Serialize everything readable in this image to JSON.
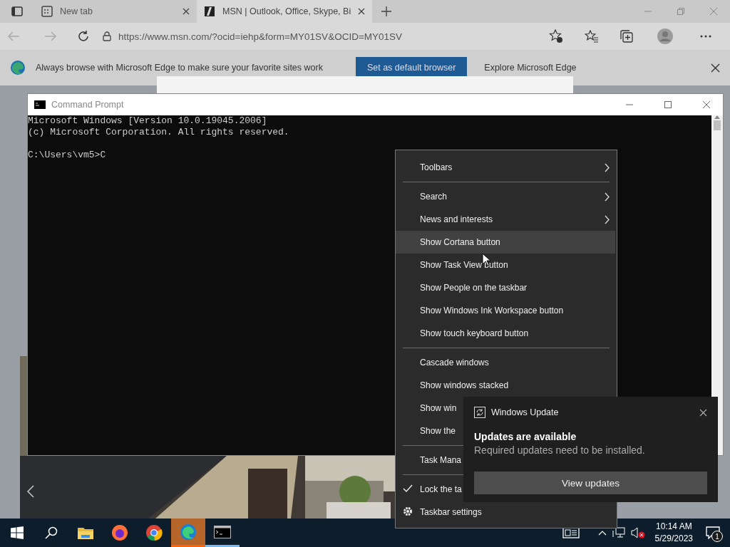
{
  "browser": {
    "tabs": [
      {
        "title": "New tab",
        "selected": false
      },
      {
        "title": "MSN | Outlook, Office, Skype, Bi",
        "selected": true
      }
    ],
    "address": "https://www.msn.com/?ocid=iehp&form=MY01SV&OCID=MY01SV",
    "infobar": {
      "message": "Always browse with Microsoft Edge to make sure your favorite sites work",
      "primary_button": "Set as default browser",
      "secondary_button": "Explore Microsoft Edge"
    }
  },
  "command_prompt": {
    "title": "Command Prompt",
    "lines": [
      "Microsoft Windows [Version 10.0.19045.2006]",
      "(c) Microsoft Corporation. All rights reserved."
    ],
    "prompt": "C:\\Users\\vm5>C"
  },
  "context_menu": {
    "groups": [
      {
        "items": [
          {
            "label": "Toolbars",
            "kind": "plain",
            "submenu": true,
            "highlighted": false,
            "checked": false
          }
        ]
      },
      {
        "items": [
          {
            "label": "Search",
            "kind": "plain",
            "submenu": true,
            "highlighted": false,
            "checked": false
          },
          {
            "label": "News and interests",
            "kind": "plain",
            "submenu": true,
            "highlighted": false,
            "checked": false
          },
          {
            "label": "Show Cortana button",
            "kind": "plain",
            "submenu": false,
            "highlighted": true,
            "checked": false
          },
          {
            "label": "Show Task View button",
            "kind": "plain",
            "submenu": false,
            "highlighted": false,
            "checked": false
          },
          {
            "label": "Show People on the taskbar",
            "kind": "plain",
            "submenu": false,
            "highlighted": false,
            "checked": false
          },
          {
            "label": "Show Windows Ink Workspace button",
            "kind": "plain",
            "submenu": false,
            "highlighted": false,
            "checked": false
          },
          {
            "label": "Show touch keyboard button",
            "kind": "plain",
            "submenu": false,
            "highlighted": false,
            "checked": false
          }
        ]
      },
      {
        "items": [
          {
            "label": "Cascade windows",
            "kind": "plain",
            "submenu": false,
            "highlighted": false,
            "checked": false
          },
          {
            "label": "Show windows stacked",
            "kind": "plain",
            "submenu": false,
            "highlighted": false,
            "checked": false
          },
          {
            "label": "Show win",
            "kind": "plain",
            "highlighted": false,
            "checked": false
          },
          {
            "label": "Show the",
            "kind": "plain",
            "highlighted": false,
            "checked": false
          }
        ]
      },
      {
        "items": [
          {
            "label": "Task Mana",
            "kind": "plain",
            "highlighted": false,
            "checked": false
          }
        ]
      },
      {
        "items": [
          {
            "label": "Lock the ta",
            "kind": "plain",
            "highlighted": false,
            "checked": true
          },
          {
            "label": "Taskbar settings",
            "kind": "settings",
            "submenu": false,
            "highlighted": false,
            "checked": false
          }
        ]
      }
    ]
  },
  "notification": {
    "app": "Windows Update",
    "title": "Updates are available",
    "body": "Required updates need to be installed.",
    "button": "View updates"
  },
  "taskbar": {
    "apps": [
      {
        "kind": "explorer",
        "running": false,
        "flashing": false
      },
      {
        "kind": "firefox",
        "running": false,
        "flashing": false
      },
      {
        "kind": "chrome",
        "running": false,
        "flashing": false
      },
      {
        "kind": "edge",
        "running": true,
        "flashing": true
      },
      {
        "kind": "terminal",
        "running": true,
        "flashing": false
      }
    ],
    "time": "10:14 AM",
    "date": "5/29/2023",
    "notification_count": "1"
  }
}
